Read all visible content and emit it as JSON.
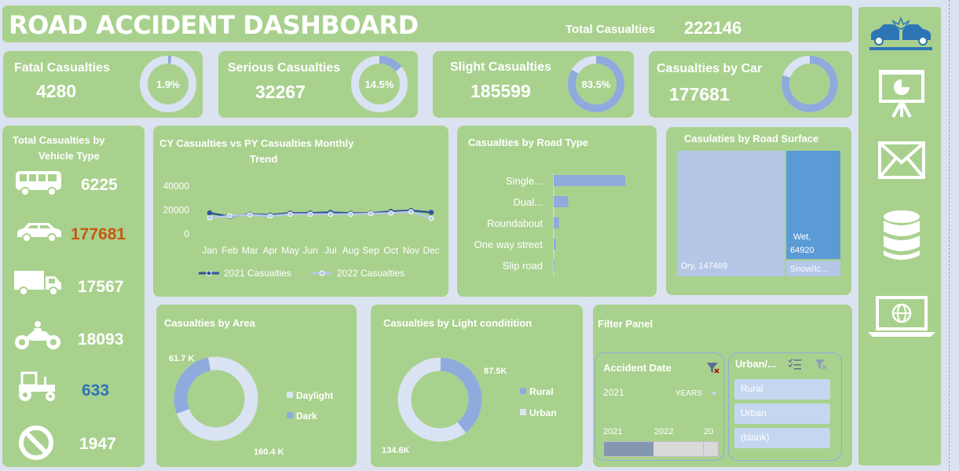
{
  "header": {
    "title": "ROAD ACCIDENT DASHBOARD",
    "total_label": "Total Casualties",
    "total_value": "222146"
  },
  "kpis": [
    {
      "label": "Fatal Casualties",
      "value": "4280",
      "pct_label": "1.9%",
      "pct": 1.9
    },
    {
      "label": "Serious Casualties",
      "value": "32267",
      "pct_label": "14.5%",
      "pct": 14.5
    },
    {
      "label": "Slight Casualties",
      "value": "185599",
      "pct_label": "83.5%",
      "pct": 83.5
    },
    {
      "label": "Casualties by Car",
      "value": "177681",
      "pct_label": "",
      "pct": 80
    }
  ],
  "vehicle": {
    "title1": "Total Casualties  by",
    "title2": "Vehicle Type",
    "items": [
      {
        "icon": "bus-icon",
        "value": "6225",
        "color": "#ffffff"
      },
      {
        "icon": "car-icon",
        "value": "177681",
        "color": "#c55a11"
      },
      {
        "icon": "truck-icon",
        "value": "17567",
        "color": "#ffffff"
      },
      {
        "icon": "motorcycle-icon",
        "value": "18093",
        "color": "#ffffff"
      },
      {
        "icon": "tractor-icon",
        "value": "633",
        "color": "#2e75b6"
      },
      {
        "icon": "no-entry-icon",
        "value": "1947",
        "color": "#ffffff"
      }
    ]
  },
  "trend": {
    "title1": "CY Casualties vs PY Casualties Monthly",
    "title2": "Trend",
    "legend": [
      "2021 Casualties",
      "2022 Casualties"
    ]
  },
  "road_type": {
    "title": "Casualties by Road Type"
  },
  "surface": {
    "title": "Casulaties by Road Surface",
    "dry_label": "Dry, 147469",
    "wet_label1": "Wet,",
    "wet_label2": "64920",
    "snow_label": "Snow/Ic..."
  },
  "area": {
    "title": "Casualties by Area",
    "legend": [
      "Daylight",
      "Dark"
    ],
    "label_top": "61.7 K",
    "label_bottom": "160.4 K"
  },
  "light": {
    "title": "Casualties by Light conditition",
    "legend": [
      "Rural",
      "Urban"
    ],
    "label_top": "87.5K",
    "label_bottom": "134.6K"
  },
  "filter": {
    "title": "Filter Panel",
    "date_title": "Accident Date",
    "date_selected": "2021",
    "date_level": "YEARS",
    "timeline": [
      "2021",
      "2022",
      "20"
    ],
    "urban_title": "Urban/...",
    "urban_items": [
      "Rural",
      "Urban",
      "(blank)"
    ]
  },
  "colors": {
    "panel": "#a9d18e",
    "background": "#dce3f0",
    "cy_line": "#2f5597",
    "py_line": "#b4c7e7",
    "bar": "#8faadc",
    "wet": "#5b9bd5",
    "dry": "#b4c7e7"
  },
  "chart_data": [
    {
      "type": "line",
      "title": "CY Casualties vs PY Casualties Monthly Trend",
      "x": [
        "Jan",
        "Feb",
        "Mar",
        "Apr",
        "May",
        "Jun",
        "Jul",
        "Aug",
        "Sep",
        "Oct",
        "Nov",
        "Dec"
      ],
      "ylim": [
        0,
        40000
      ],
      "yticks": [
        "40000",
        "20000",
        "0"
      ],
      "series": [
        {
          "name": "2021 Casualties",
          "values": [
            17500,
            14500,
            16500,
            15800,
            17500,
            17500,
            18000,
            17300,
            17500,
            18800,
            19500,
            18000
          ]
        },
        {
          "name": "2022 Casualties",
          "values": [
            13500,
            15000,
            16000,
            15000,
            16500,
            16500,
            16500,
            16500,
            17000,
            17500,
            18500,
            13000
          ]
        }
      ],
      "legend_position": "bottom"
    },
    {
      "type": "bar",
      "title": "Casualties by Road Type",
      "categories": [
        "Single...",
        "Dual...",
        "Roundabout",
        "One way street",
        "Slip road"
      ],
      "values": [
        163000,
        33000,
        12000,
        4500,
        2000
      ],
      "xlim": [
        0,
        170000
      ]
    },
    {
      "type": "area",
      "title": "Casulaties by Road Surface",
      "categories": [
        "Dry",
        "Wet",
        "Snow/Ic..."
      ],
      "values": [
        147469,
        64920,
        9757
      ]
    },
    {
      "type": "pie",
      "title": "Casualties by Area",
      "categories": [
        "Daylight",
        "Dark"
      ],
      "values": [
        160400,
        61700
      ],
      "labels": [
        "160.4 K",
        "61.7 K"
      ]
    },
    {
      "type": "pie",
      "title": "Casualties by Light conditition",
      "categories": [
        "Rural",
        "Urban"
      ],
      "values": [
        87500,
        134600
      ],
      "labels": [
        "87.5K",
        "134.6K"
      ]
    }
  ]
}
